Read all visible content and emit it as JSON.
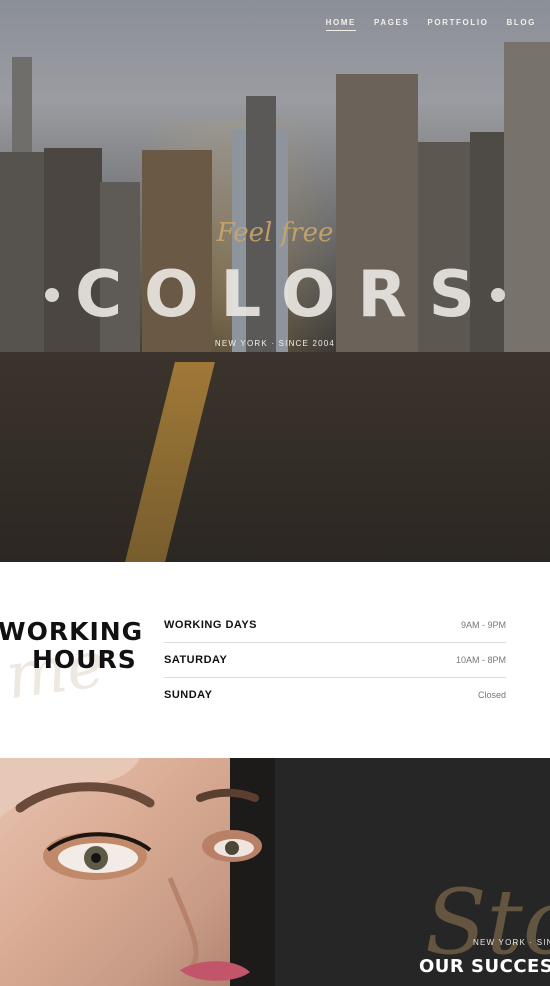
{
  "nav": {
    "items": [
      {
        "label": "HOME"
      },
      {
        "label": "PAGES"
      },
      {
        "label": "PORTFOLIO"
      },
      {
        "label": "BLOG"
      }
    ]
  },
  "hero": {
    "script": "Feel free",
    "title": "COLORS",
    "subtitle": "NEW YORK · SINCE 2004"
  },
  "hours": {
    "title_line1": "WORKING",
    "title_line2": "HOURS",
    "rows": [
      {
        "day": "WORKING DAYS",
        "time": "9AM - 9PM"
      },
      {
        "day": "SATURDAY",
        "time": "10AM - 8PM"
      },
      {
        "day": "SUNDAY",
        "time": "Closed"
      }
    ]
  },
  "story": {
    "script": "Sto",
    "subtitle": "NEW YORK · SIN",
    "title": "OUR SUCCESS"
  }
}
